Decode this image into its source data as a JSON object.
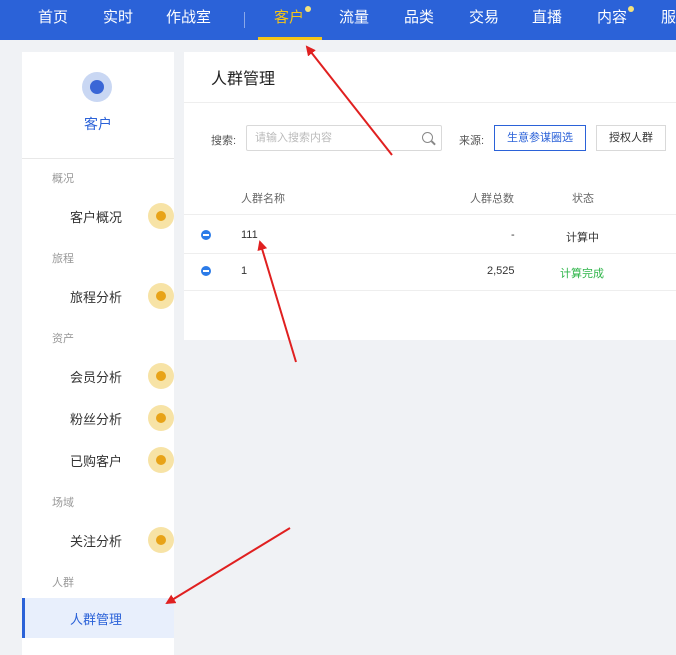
{
  "topnav": {
    "items": [
      {
        "label": "首页"
      },
      {
        "label": "实时"
      },
      {
        "label": "作战室"
      },
      {
        "label": "客户"
      },
      {
        "label": "流量"
      },
      {
        "label": "品类"
      },
      {
        "label": "交易"
      },
      {
        "label": "直播"
      },
      {
        "label": "内容"
      },
      {
        "label": "服"
      }
    ],
    "active": "客户",
    "accent_color": "#f5c518",
    "bar_color": "#2b62d8"
  },
  "sidebar": {
    "title": "客户",
    "groups": {
      "overview": "概况",
      "journey": "旅程",
      "assets": "资产",
      "scene": "场域",
      "crowd": "人群"
    },
    "items": {
      "customer_overview": "客户概况",
      "journey_analysis": "旅程分析",
      "member_analysis": "会员分析",
      "fan_analysis": "粉丝分析",
      "purchased_customers": "已购客户",
      "follow_analysis": "关注分析",
      "crowd_management": "人群管理"
    }
  },
  "main": {
    "title": "人群管理",
    "search": {
      "label": "搜索:",
      "placeholder": "请输入搜索内容",
      "value": ""
    },
    "source": {
      "label": "来源:",
      "options": [
        "生意参谋圈选",
        "授权人群"
      ],
      "selected": "生意参谋圈选"
    },
    "table": {
      "headers": {
        "name": "人群名称",
        "total": "人群总数",
        "status": "状态"
      },
      "rows": [
        {
          "name": "111",
          "total": "-",
          "status": "计算中"
        },
        {
          "name": "1",
          "total": "2,525",
          "status": "计算完成"
        }
      ]
    }
  }
}
